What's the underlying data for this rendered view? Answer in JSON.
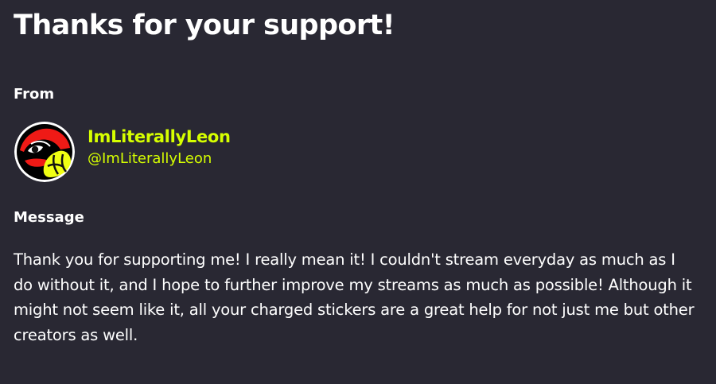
{
  "title": "Thanks for your support!",
  "from_section": {
    "label": "From",
    "sender": {
      "display_name": "ImLiterallyLeon",
      "handle": "@ImLiterallyLeon",
      "avatar_icon": "red-yellow-turtle-avatar-icon",
      "name_color": "#d6ff00"
    }
  },
  "message_section": {
    "label": "Message",
    "body": "Thank you for supporting me! I really mean it! I couldn't stream everyday as much as I do without it, and I hope to further improve my streams as much as possible! Although it might not seem like it, all your charged stickers are a great help for not just me but other creators as well."
  },
  "colors": {
    "background": "#292833",
    "text": "#ffffff",
    "accent": "#d6ff00"
  }
}
